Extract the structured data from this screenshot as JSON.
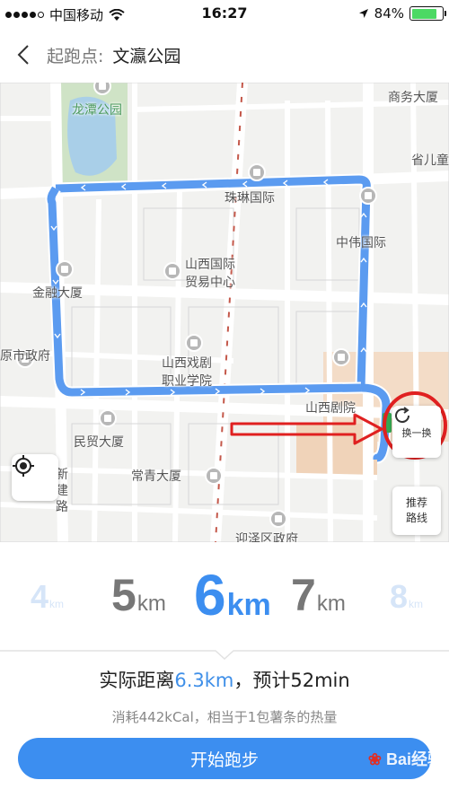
{
  "status_bar": {
    "carrier": "中国移动",
    "time": "16:27",
    "battery": "84%",
    "battery_level": 0.84
  },
  "nav": {
    "start_label": "起跑点:",
    "start_place": "文瀛公园"
  },
  "map": {
    "labels": {
      "longtan_park": "龙潭公园",
      "shangwu": "商务大厦",
      "shengji": "省儿童",
      "zhulin": "珠琳国际",
      "zhongwei": "中伟国际",
      "shanxi_intl_1": "山西国际",
      "shanxi_intl_2": "贸易中心",
      "jinrong": "金融大厦",
      "drama_school_1": "山西戏剧",
      "drama_school_2": "职业学院",
      "city_gov": "原市政府",
      "theater": "山西剧院",
      "minying": "民贸大厦",
      "changqing": "常青大厦",
      "xinjian_road": "新建路",
      "yingze_gov": "迎泽区政府"
    },
    "switch_button": "换一换",
    "recommend_button": [
      "推荐",
      "路线"
    ]
  },
  "picker": {
    "unit": "km",
    "options": [
      "4",
      "5",
      "6",
      "7",
      "8"
    ],
    "selected": "6"
  },
  "summary": {
    "prefix": "实际距离",
    "distance": "6.3km",
    "suffix": "，预计52min",
    "calories": "消耗442kCal，相当于1包薯条的热量"
  },
  "start_button": "开始跑步",
  "watermark": "Bai经验",
  "colors": {
    "route": "#5b9bf0",
    "accent": "#3c8ef0",
    "annotation": "#e02020"
  }
}
